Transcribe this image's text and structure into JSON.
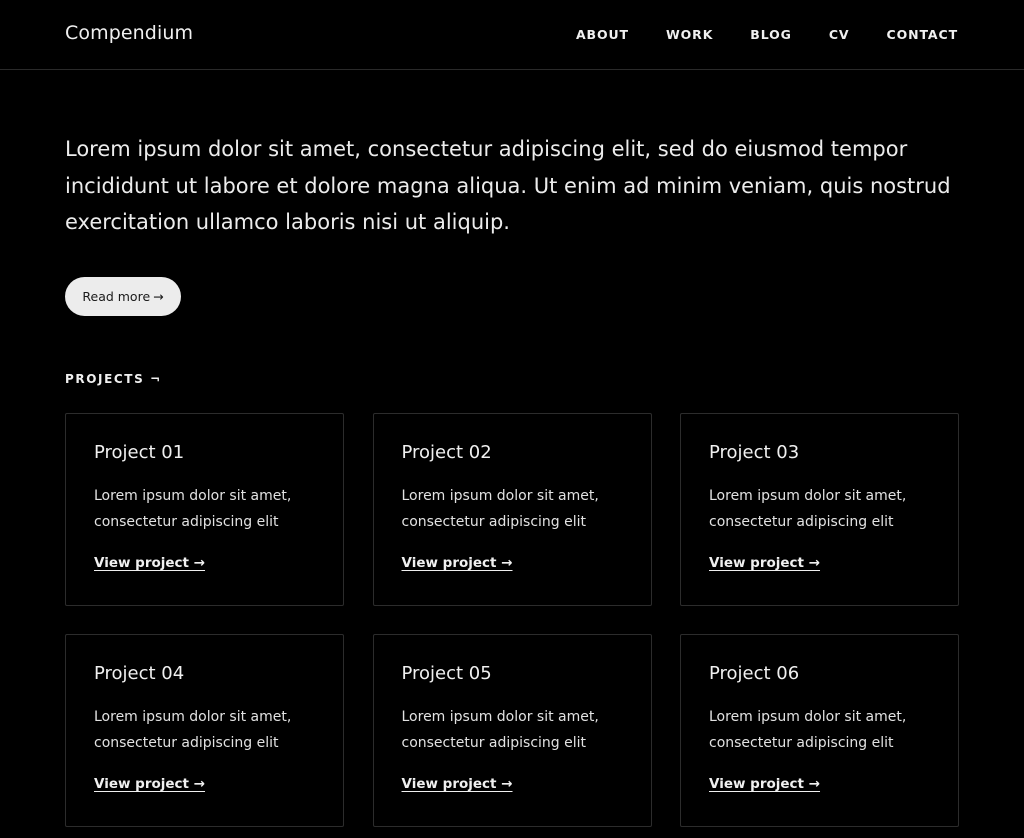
{
  "header": {
    "brand": "Compendium",
    "nav": [
      "ABOUT",
      "WORK",
      "BLOG",
      "CV",
      "CONTACT"
    ]
  },
  "hero": {
    "text": "Lorem ipsum dolor sit amet, consectetur adipiscing elit, sed do eiusmod tempor incididunt ut labore et dolore magna aliqua. Ut enim ad minim veniam, quis nostrud exercitation ullamco laboris nisi ut aliquip.",
    "button_label": "Read more",
    "button_arrow": "→"
  },
  "projects": {
    "label": "PROJECTS ¬",
    "items": [
      {
        "title": "Project 01",
        "desc": "Lorem ipsum dolor sit amet, consectetur adipiscing elit",
        "link": "View project →"
      },
      {
        "title": "Project 02",
        "desc": "Lorem ipsum dolor sit amet, consectetur adipiscing elit",
        "link": "View project →"
      },
      {
        "title": "Project 03",
        "desc": "Lorem ipsum dolor sit amet, consectetur adipiscing elit",
        "link": "View project →"
      },
      {
        "title": "Project 04",
        "desc": "Lorem ipsum dolor sit amet, consectetur adipiscing elit",
        "link": "View project →"
      },
      {
        "title": "Project 05",
        "desc": "Lorem ipsum dolor sit amet, consectetur adipiscing elit",
        "link": "View project →"
      },
      {
        "title": "Project 06",
        "desc": "Lorem ipsum dolor sit amet, consectetur adipiscing elit",
        "link": "View project →"
      }
    ]
  },
  "colors": {
    "background": "#000000",
    "text": "#f0f0f0",
    "button_bg": "#ececec",
    "card_border": "#2c2c2c"
  }
}
